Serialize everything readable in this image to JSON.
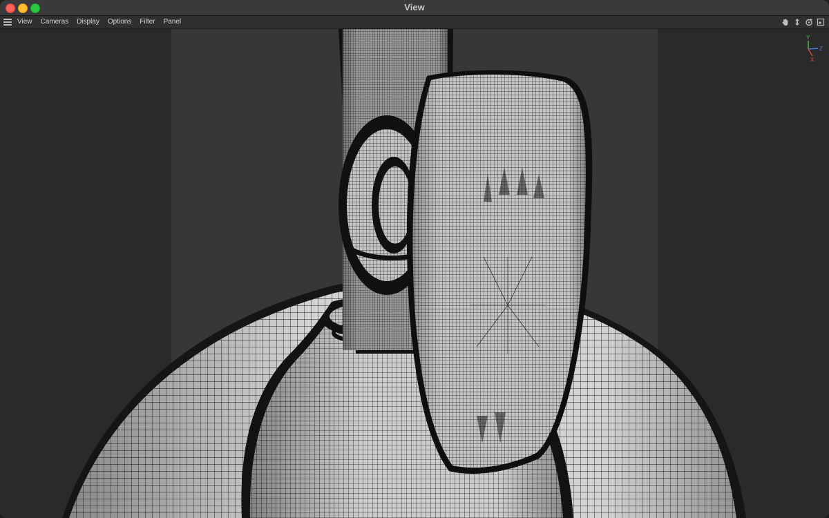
{
  "window": {
    "title": "View"
  },
  "menubar": {
    "menu_icon": "hamburger-menu-icon",
    "items": [
      "View",
      "Cameras",
      "Display",
      "Options",
      "Filter",
      "Panel"
    ]
  },
  "nav_tools": [
    "pan-hand-icon",
    "dolly-arrow-icon",
    "orbit-rotate-icon",
    "maximize-view-icon"
  ],
  "axis_gizmo": {
    "y": "Y",
    "z": "Z",
    "x": "X"
  },
  "colors": {
    "y_axis": "#4cc24c",
    "z_axis": "#4a7bd8",
    "x_axis": "#d94a3a",
    "viewport_bg": "#2a2a2a",
    "safe_frame": "#373737",
    "mesh_fill": "#c8c8c8",
    "wire": "#141414"
  },
  "viewport": {
    "display_mode": "wireframe-shaded",
    "subject": "3d-mesh-model"
  }
}
